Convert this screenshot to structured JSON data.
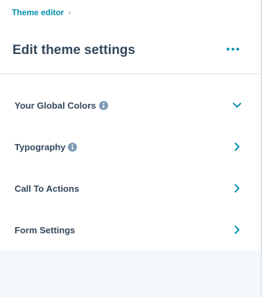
{
  "breadcrumb": {
    "link_label": "Theme editor",
    "chevron": "›"
  },
  "header": {
    "title": "Edit theme settings",
    "more_icon": "more-horizontal-icon"
  },
  "sections": [
    {
      "label": "Your Global Colors",
      "has_info": true,
      "expanded": true
    },
    {
      "label": "Typography",
      "has_info": true,
      "expanded": false
    },
    {
      "label": "Call To Actions",
      "has_info": false,
      "expanded": false
    },
    {
      "label": "Form Settings",
      "has_info": false,
      "expanded": false
    }
  ],
  "colors": {
    "accent": "#0091ae",
    "text": "#33475b",
    "info_icon": "#7c98b6",
    "divider": "#dfe3eb"
  }
}
